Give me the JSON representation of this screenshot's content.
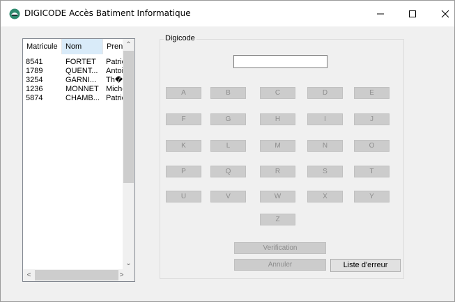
{
  "window": {
    "title": "DIGICODE Accès Batiment Informatique",
    "controls": {
      "minimize": "minimize",
      "maximize": "maximize",
      "close": "close"
    }
  },
  "list": {
    "columns": [
      "Matricule",
      "Nom",
      "Prenc"
    ],
    "rows": [
      [
        "8541",
        "FORTET",
        "Patric"
      ],
      [
        "1789",
        "QUENT...",
        "Antoir"
      ],
      [
        "3254",
        "GARNI...",
        "Th�o"
      ],
      [
        "1236",
        "MONNET",
        "Miche"
      ],
      [
        "5874",
        "CHAMB...",
        "Patric"
      ]
    ]
  },
  "digicode": {
    "group_label": "Digicode",
    "input_value": "",
    "keys": [
      "A",
      "B",
      "C",
      "D",
      "E",
      "F",
      "G",
      "H",
      "I",
      "J",
      "K",
      "L",
      "M",
      "N",
      "O",
      "P",
      "Q",
      "R",
      "S",
      "T",
      "U",
      "V",
      "W",
      "X",
      "Y",
      "Z"
    ],
    "verification_label": "Verification",
    "annuler_label": "Annuler",
    "errors_label": "Liste d'erreur"
  },
  "colors": {
    "app_icon": "#2d8a6e",
    "disabled_key": "#cccccc",
    "disabled_text": "#8d8d8d",
    "header_active": "#d9ebf9"
  }
}
